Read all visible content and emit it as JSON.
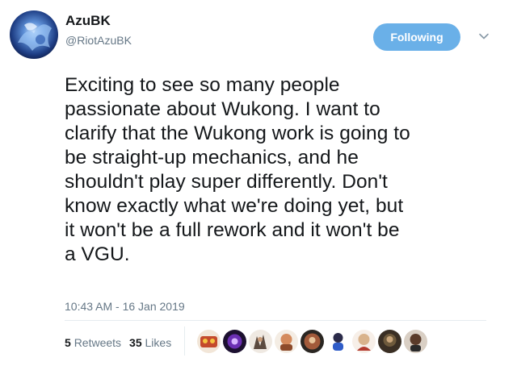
{
  "author": {
    "display_name": "AzuBK",
    "handle": "@RiotAzuBK"
  },
  "follow_button": {
    "label": "Following",
    "color": "#6ab0e8"
  },
  "tweet": {
    "lines": [
      "Exciting to see so many people",
      "passionate about Wukong. I want to",
      "clarify that the Wukong work is going to",
      "be straight-up mechanics, and he",
      "shouldn't play super differently. Don't",
      "know exactly what we're doing yet, but",
      "it won't be a full rework and it won't be",
      "a VGU."
    ],
    "timestamp": "10:43 AM - 16 Jan 2019"
  },
  "stats": {
    "retweets_count": "5",
    "retweets_label": "Retweets",
    "likes_count": "35",
    "likes_label": "Likes"
  },
  "likers": [
    "avatar-1",
    "avatar-2",
    "avatar-3",
    "avatar-4",
    "avatar-5",
    "avatar-6",
    "avatar-7",
    "avatar-8",
    "avatar-9"
  ]
}
